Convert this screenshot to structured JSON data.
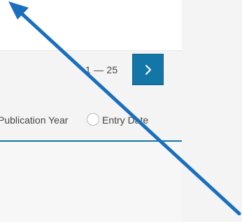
{
  "pagination": {
    "range_text": "1 — 25",
    "next_label": "›"
  },
  "sort": {
    "options": [
      {
        "label": "Publication Year"
      },
      {
        "label": "Entry Date"
      }
    ]
  },
  "colors": {
    "accent": "#1376A6",
    "annotation": "#1A6FBE"
  },
  "icons": {
    "next": "chevron-right-icon",
    "annotation": "arrow-up-left-icon"
  }
}
